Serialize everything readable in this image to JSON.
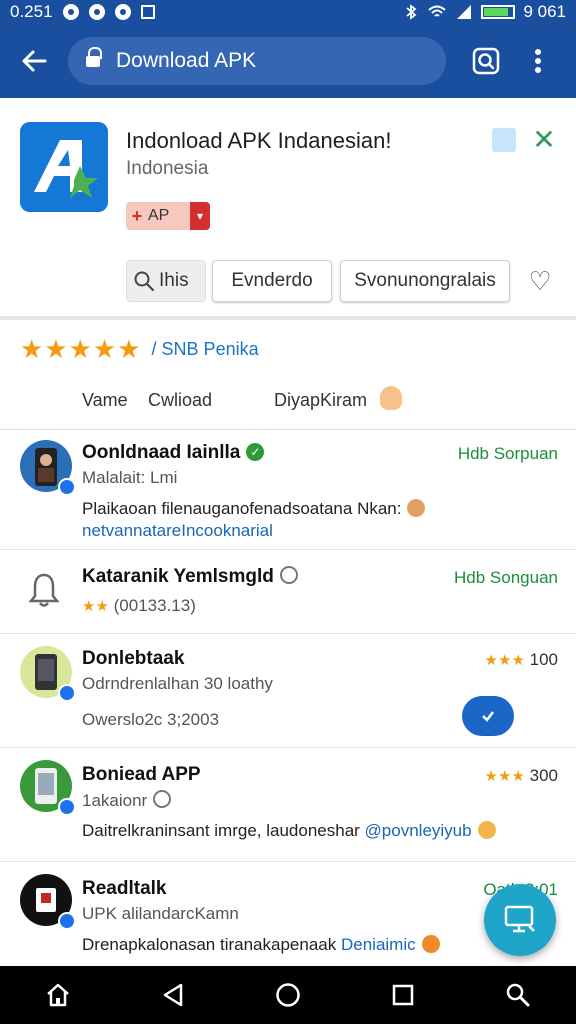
{
  "status_bar": {
    "time": "0.251",
    "right_text": "9 061"
  },
  "app_bar": {
    "url_text": "Download APK"
  },
  "app_header": {
    "title": "Indonload APK Indanesian!",
    "subtitle": "Indonesia",
    "badge_label": "AP"
  },
  "filters": {
    "search_label": "Ihis",
    "chip1": "Evnderdo",
    "chip2": "Svonunongralais"
  },
  "rating": {
    "star_count": 5,
    "link_text": "/ SNB Penika"
  },
  "sort": {
    "col1": "Vame",
    "col2": "Cwlioad",
    "col3": "DiyapKiram"
  },
  "items": [
    {
      "title": "Oonldnaad Iainlla",
      "sub": "Malalait: Lmi",
      "desc_plain": "Plaikaoan filenauganofenadsoatana Nkan:",
      "desc_link": "netvannatareIncooknarial",
      "right": "Hdb Sorpuan"
    },
    {
      "title": "Kataranik Yemlsmgld",
      "rating_text": "(00133.13)",
      "right": "Hdb Songuan"
    },
    {
      "title": "Donlebtaak",
      "sub": "Odrndrenlalhan 30 loathy",
      "meta": "Owerslo2c 3;2003",
      "rating_value": "100"
    },
    {
      "title": "Boniead APP",
      "sub": "1akaionr",
      "desc_plain": "Daitrelkraninsant imrge, laudoneshar",
      "desc_link": "@povnleyiyub",
      "rating_value": "300"
    },
    {
      "title": "Readltalk",
      "sub": "UPK alilandarcKamn",
      "desc_plain": "Drenapkalonasan tiranakapenaak",
      "desc_link": "Deniaimic",
      "right": "Oatb 2:01"
    }
  ],
  "colors": {
    "primary": "#1a4fa0",
    "accent_blue": "#1a73e8",
    "green": "#1b8f3a",
    "star": "#f39c12",
    "fab": "#1ea5c9"
  }
}
